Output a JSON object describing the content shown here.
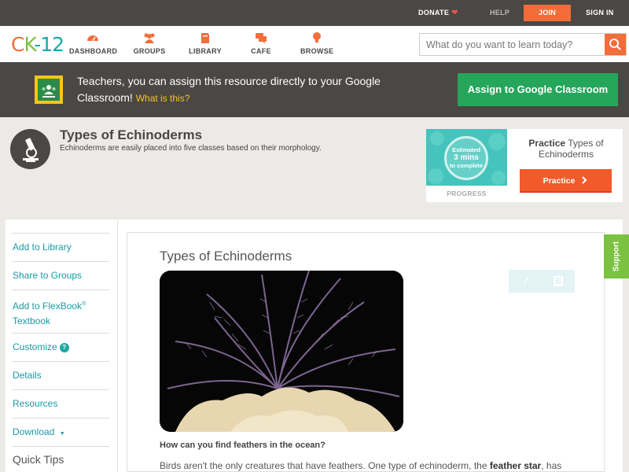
{
  "topbar": {
    "donate": "DONATE",
    "help": "HELP",
    "join": "JOIN",
    "signin": "SIGN IN"
  },
  "nav": {
    "logo": {
      "c": "C",
      "k": "K",
      "n": "-12"
    },
    "items": [
      "DASHBOARD",
      "GROUPS",
      "LIBRARY",
      "CAFE",
      "BROWSE"
    ],
    "search_placeholder": "What do you want to learn today?"
  },
  "banner": {
    "text": "Teachers, you can assign this resource directly to your Google Classroom!",
    "link": "What is this?",
    "button": "Assign to Google Classroom"
  },
  "header": {
    "title": "Types of Echinoderms",
    "subtitle": "Echinoderms are easily placed into five classes based on their morphology."
  },
  "practice": {
    "estimate_line1": "Estimated",
    "estimate_line2": "3 mins",
    "estimate_line3": "to complete",
    "progress_label": "PROGRESS",
    "prefix": "Practice",
    "topic": "Types of Echinoderms",
    "button": "Practice"
  },
  "sidebar": {
    "add_library": "Add to Library",
    "share_groups": "Share to Groups",
    "add_flexbook": "Add to FlexBook",
    "registered": "®",
    "textbook": "Textbook",
    "customize": "Customize",
    "help_mark": "?",
    "details": "Details",
    "resources": "Resources",
    "download": "Download",
    "download_arrow": "▼",
    "quick_tips": "Quick Tips"
  },
  "content": {
    "title": "Types of Echinoderms",
    "question": "How can you find feathers in the ocean?",
    "para_start": "Birds aren't the only creatures that have feathers. One type of echinoderm, the ",
    "para_bold": "feather star",
    "para_end": ", has"
  },
  "support": "Support",
  "colors": {
    "accent_orange": "#f26d3a",
    "brand_green": "#7cc242",
    "teal": "#1aa8a4",
    "dark_bar": "#4a4744",
    "classroom_green": "#25a65a"
  }
}
